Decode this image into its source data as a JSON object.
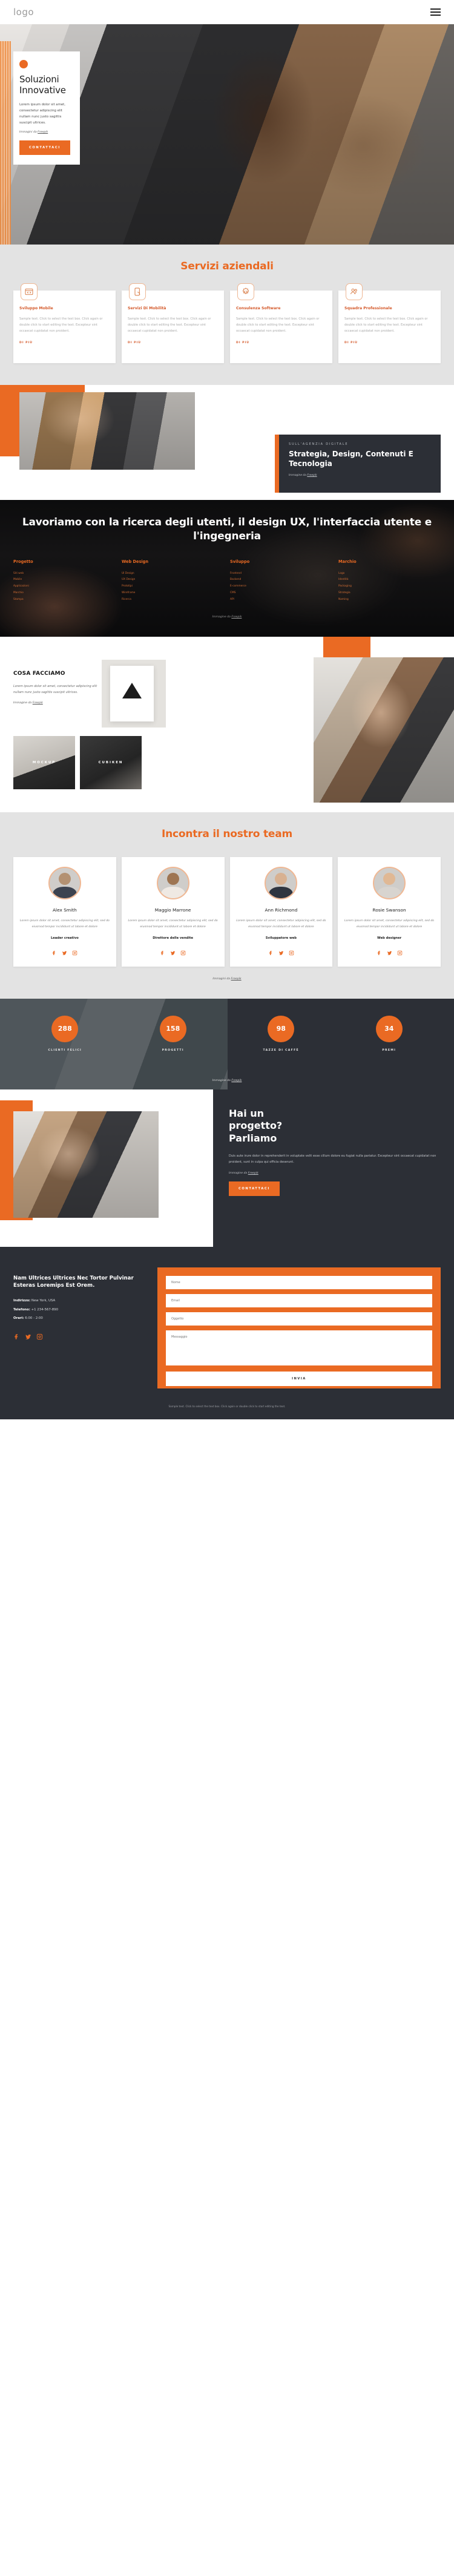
{
  "brand": {
    "logo": "logo",
    "accent": "#ea6a23",
    "dark": "#2c2f36"
  },
  "header": {
    "menu_icon": "hamburger-icon"
  },
  "hero": {
    "title": "Soluzioni\nInnovative",
    "title_line1": "Soluzioni",
    "title_line2": "Innovative",
    "paragraph": "Lorem ipsum dolor sit amet, consectetur adipiscing elit nullam nunc justo sagittis suscipit ultrices.",
    "credit_prefix": "Immagini da ",
    "credit_link": "Freepik",
    "cta_label": "CONTATTACI"
  },
  "services": {
    "heading": "Servizi aziendali",
    "more_label": "DI PIÙ",
    "body": "Sample text. Click to select the text box. Click again or double click to start editing the text. Excepteur sint occaecat cupidatat non proident.",
    "cards": [
      {
        "title": "Sviluppo Mobile",
        "icon": "code-window-icon"
      },
      {
        "title": "Servizi Di Mobilità",
        "icon": "mobile-tap-icon"
      },
      {
        "title": "Consulenza Software",
        "icon": "gear-code-icon"
      },
      {
        "title": "Squadra Professionale",
        "icon": "people-group-icon"
      }
    ]
  },
  "banner": {
    "eyebrow": "SULL'AGENZIA DIGITALE",
    "title": "Strategia, Design, Contenuti E Tecnologia",
    "credit_prefix": "Immagine da ",
    "credit_link": "Freepik"
  },
  "process": {
    "title": "Lavoriamo con la ricerca degli utenti, il design UX, l'interfaccia utente e l'ingegneria",
    "credit_prefix": "Immagine da ",
    "credit_link": "Freepik",
    "columns": [
      {
        "heading": "Progetto",
        "items": [
          "Siti web",
          "Mobile",
          "Applicazioni",
          "Marchio",
          "Stampa"
        ]
      },
      {
        "heading": "Web Design",
        "items": [
          "UI Design",
          "UX Design",
          "Prototipi",
          "Wireframe",
          "Ricerca"
        ]
      },
      {
        "heading": "Sviluppo",
        "items": [
          "Frontend",
          "Backend",
          "E-commerce",
          "CMS",
          "API"
        ]
      },
      {
        "heading": "Marchio",
        "items": [
          "Logo",
          "Identità",
          "Packaging",
          "Strategia",
          "Naming"
        ]
      }
    ]
  },
  "about": {
    "heading": "COSA FACCIAMO",
    "paragraph": "Lorem ipsum dolor sit amet, consectetur adipiscing elit nullam nunc justo sagittis suscipit ultrices.",
    "credit_prefix": "Immagine da ",
    "credit_link": "Freepik",
    "tile_label_1": "MOCKUP",
    "tile_label_2": "CUBIKEN"
  },
  "team": {
    "heading": "Incontra il nostro team",
    "bio": "Lorem ipsum dolor sit amet, consectetur adipiscing elit, sed do eiusmod tempor incididunt ut labore et dolore",
    "credit_prefix": "Immagini da ",
    "credit_link": "Freepik",
    "members": [
      {
        "name": "Alex Smith",
        "role": "Leader creativo"
      },
      {
        "name": "Maggio Marrone",
        "role": "Direttore delle vendite"
      },
      {
        "name": "Ann Richmond",
        "role": "Sviluppatore web"
      },
      {
        "name": "Rosie Swanson",
        "role": "Web designer"
      }
    ],
    "socials": [
      "facebook-icon",
      "twitter-icon",
      "instagram-icon"
    ]
  },
  "counters": {
    "credit_prefix": "Immagine da ",
    "credit_link": "Freepik",
    "items": [
      {
        "value": "288",
        "label": "CLIENTI FELICI"
      },
      {
        "value": "158",
        "label": "PROGETTI"
      },
      {
        "value": "98",
        "label": "TAZZE DI CAFFÈ"
      },
      {
        "value": "34",
        "label": "PREMI"
      }
    ]
  },
  "cta": {
    "title_line1": "Hai un",
    "title_line2": "progetto?",
    "title_line3": "Parliamo",
    "paragraph": "Duis aute irure dolor in reprehenderit in voluptate velit esse cillum dolore eu fugiat nulla pariatur. Excepteur sint occaecat cupidatat non proident, sunt in culpa qui officia deserunt.",
    "credit_prefix": "Immagine da ",
    "credit_link": "Freepik",
    "button_label": "CONTATTACI"
  },
  "footer": {
    "title": "Nam Ultrices Ultrices Nec Tortor Pulvinar Esteras Loremips Est Orem.",
    "address_label": "Indirizzo:",
    "address_value": " New York, USA",
    "phone_label": "Telefono:",
    "phone_value": " +1 234-567-890",
    "hours_label": "Orari:",
    "hours_value": " 6:00 - 2:00",
    "socials": [
      "facebook-icon",
      "twitter-icon",
      "instagram-icon"
    ],
    "form": {
      "name_placeholder": "Nome",
      "email_placeholder": "Email",
      "subject_placeholder": "Oggetto",
      "message_placeholder": "Messaggio",
      "submit_label": "INVIA"
    },
    "copyright": "Sample text. Click to select the text box. Click again or double click to start editing the text."
  }
}
